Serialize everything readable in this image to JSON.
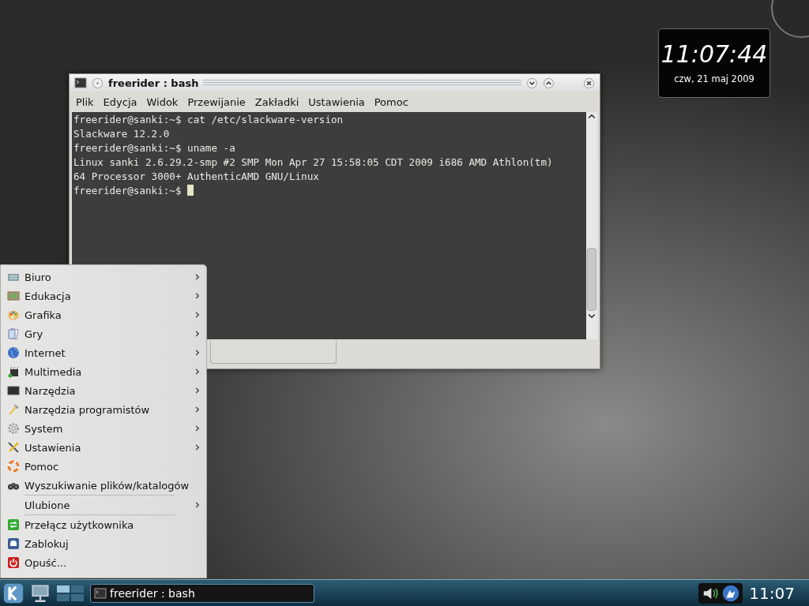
{
  "terminal": {
    "title": "freerider : bash",
    "menu": [
      "Plik",
      "Edycja",
      "Widok",
      "Przewijanie",
      "Zakładki",
      "Ustawienia",
      "Pomoc"
    ],
    "lines": [
      "freerider@sanki:~$ cat /etc/slackware-version",
      "Slackware 12.2.0",
      "freerider@sanki:~$ uname -a",
      "Linux sanki 2.6.29.2-smp #2 SMP Mon Apr 27 15:58:05 CDT 2009 i686 AMD Athlon(tm)",
      "64 Processor 3000+ AuthenticAMD GNU/Linux",
      "freerider@sanki:~$ "
    ]
  },
  "clock": {
    "time": "11:07:44",
    "date": "czw, 21 maj 2009"
  },
  "kmenu": {
    "sections": [
      [
        {
          "label": "Biuro",
          "submenu": true
        },
        {
          "label": "Edukacja",
          "submenu": true
        },
        {
          "label": "Grafika",
          "submenu": true
        },
        {
          "label": "Gry",
          "submenu": true
        },
        {
          "label": "Internet",
          "submenu": true
        },
        {
          "label": "Multimedia",
          "submenu": true
        },
        {
          "label": "Narzędzia",
          "submenu": true
        },
        {
          "label": "Narzędzia programistów",
          "submenu": true
        },
        {
          "label": "System",
          "submenu": true
        },
        {
          "label": "Ustawienia",
          "submenu": true
        },
        {
          "label": "Pomoc",
          "submenu": false
        },
        {
          "label": "Wyszukiwanie plików/katalogów",
          "submenu": false
        }
      ],
      [
        {
          "label": "Ulubione",
          "submenu": true
        }
      ],
      [
        {
          "label": "Przełącz użytkownika",
          "submenu": false
        },
        {
          "label": "Zablokuj",
          "submenu": false
        },
        {
          "label": "Opuść...",
          "submenu": false
        }
      ]
    ]
  },
  "taskbar": {
    "tasks": [
      {
        "label": "freerider : bash",
        "selected": true
      }
    ],
    "time": "11:07"
  }
}
